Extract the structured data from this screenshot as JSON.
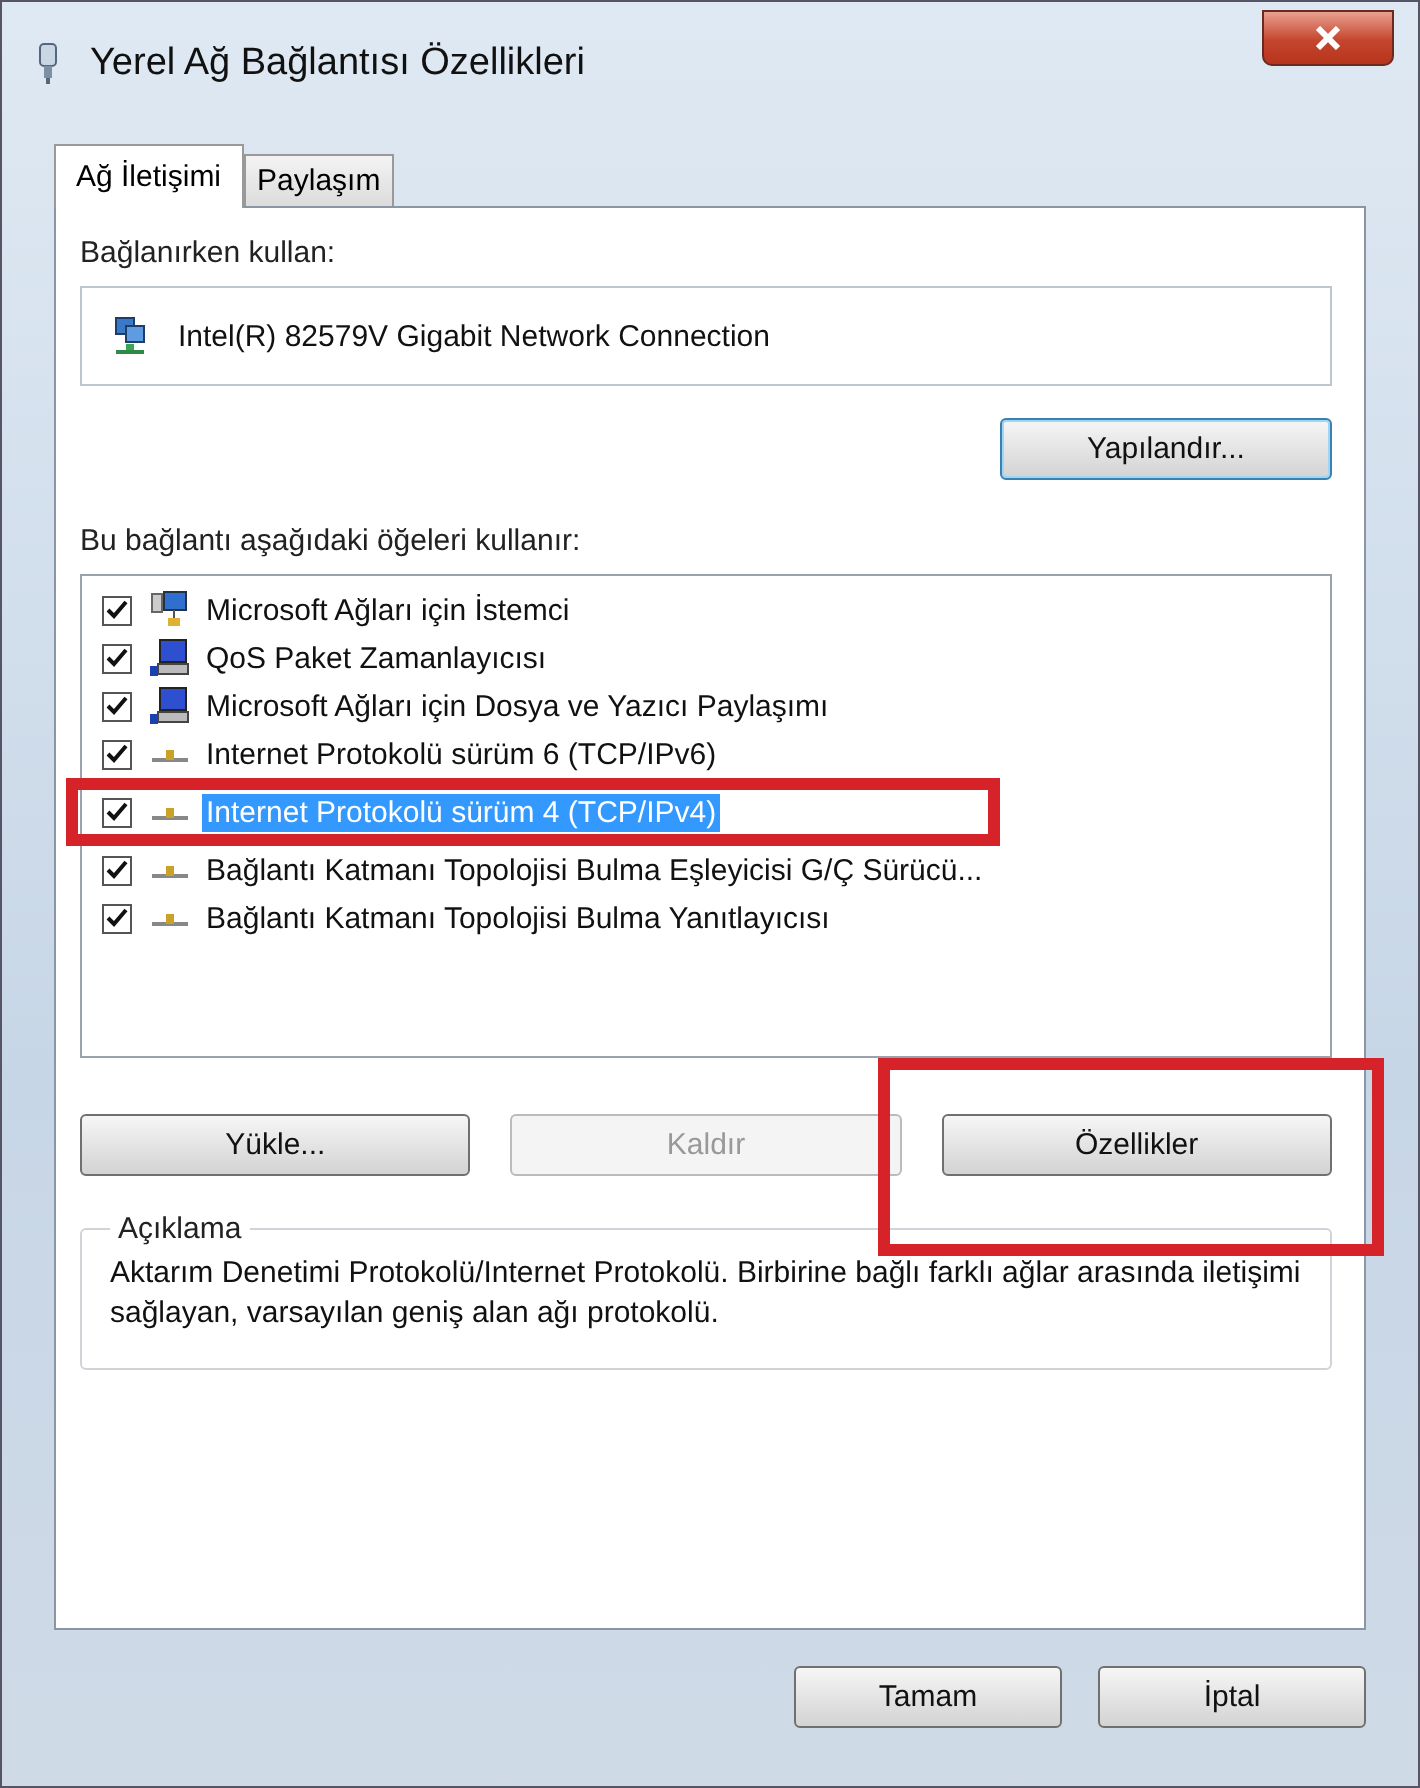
{
  "window": {
    "title": "Yerel Ağ Bağlantısı Özellikleri"
  },
  "tabs": [
    {
      "label": "Ağ İletişimi",
      "selected": true
    },
    {
      "label": "Paylaşım",
      "selected": false
    }
  ],
  "connect_using": {
    "label": "Bağlanırken kullan:",
    "adapter": "Intel(R) 82579V Gigabit Network Connection",
    "configure_button": "Yapılandır..."
  },
  "items_label": "Bu bağlantı aşağıdaki öğeleri kullanır:",
  "items": [
    {
      "label": "Microsoft Ağları için İstemci",
      "kind": "client",
      "checked": true,
      "selected": false,
      "annotated": false
    },
    {
      "label": "QoS Paket Zamanlayıcısı",
      "kind": "service",
      "checked": true,
      "selected": false,
      "annotated": false
    },
    {
      "label": "Microsoft Ağları için Dosya ve Yazıcı Paylaşımı",
      "kind": "service",
      "checked": true,
      "selected": false,
      "annotated": false
    },
    {
      "label": "Internet Protokolü sürüm 6 (TCP/IPv6)",
      "kind": "protocol",
      "checked": true,
      "selected": false,
      "annotated": false
    },
    {
      "label": "Internet Protokolü sürüm 4 (TCP/IPv4)",
      "kind": "protocol",
      "checked": true,
      "selected": true,
      "annotated": true
    },
    {
      "label": "Bağlantı Katmanı Topolojisi Bulma Eşleyicisi G/Ç Sürücü...",
      "kind": "protocol",
      "checked": true,
      "selected": false,
      "annotated": false
    },
    {
      "label": "Bağlantı Katmanı Topolojisi Bulma Yanıtlayıcısı",
      "kind": "protocol",
      "checked": true,
      "selected": false,
      "annotated": false
    }
  ],
  "item_buttons": [
    {
      "label": "Yükle...",
      "disabled": false,
      "annotated": false
    },
    {
      "label": "Kaldır",
      "disabled": true,
      "annotated": false
    },
    {
      "label": "Özellikler",
      "disabled": false,
      "annotated": true
    }
  ],
  "description": {
    "title": "Açıklama",
    "text": "Aktarım Denetimi Protokolü/Internet Protokolü. Birbirine bağlı farklı ağlar arasında iletişimi sağlayan, varsayılan geniş alan ağı protokolü."
  },
  "dialog_buttons": [
    {
      "label": "Tamam"
    },
    {
      "label": "İptal"
    }
  ]
}
